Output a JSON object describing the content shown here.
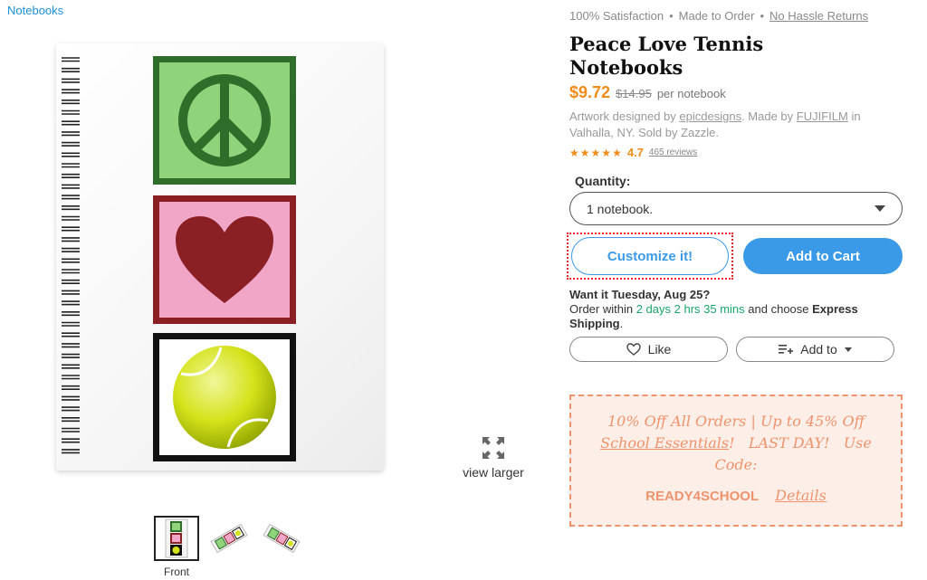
{
  "breadcrumb": {
    "label": "Notebooks"
  },
  "gallery": {
    "view_larger_label": "view larger",
    "thumbnails": [
      {
        "label": "Front",
        "active": true
      },
      {
        "label": "",
        "active": false
      },
      {
        "label": "",
        "active": false
      }
    ]
  },
  "product": {
    "guarantees": [
      "100% Satisfaction",
      "Made to Order",
      "No Hassle Returns"
    ],
    "title_line1": "Peace Love Tennis",
    "title_line2": "Notebooks",
    "price": "$9.72",
    "old_price": "$14.95",
    "price_unit": "per notebook",
    "credits": {
      "prefix": "Artwork designed by",
      "designer": "epicdesigns",
      "made_by": ". Made by",
      "maker": "FUJIFILM",
      "suffix": "in Valhalla, NY. Sold by Zazzle."
    },
    "rating": {
      "value": "4.7",
      "stars": 5,
      "reviews": "465 reviews"
    }
  },
  "quantity": {
    "label": "Quantity:",
    "selected": "1 notebook."
  },
  "actions": {
    "customize": "Customize it!",
    "add_to_cart": "Add to Cart",
    "like": "Like",
    "add_to": "Add to"
  },
  "delivery": {
    "headline": "Want it Tuesday, Aug 25?",
    "prefix": "Order within",
    "countdown": "2 days 2 hrs 35 mins",
    "middle": "and choose",
    "method": "Express Shipping",
    "end": "."
  },
  "promo": {
    "line1": "10% Off All Orders | Up to 45% Off",
    "link": "School Essentials",
    "line2_rest": "!   LAST DAY!   Use Code:",
    "code": "READY4SCHOOL",
    "details": "Details"
  },
  "colors": {
    "accent": "#3a9ae8",
    "price": "#f08c1a",
    "promo": "#f0936c",
    "countdown": "#1aa66b"
  },
  "icons": [
    "peace-icon",
    "heart-icon",
    "tennis-ball-icon",
    "expand-icon",
    "heart-outline-icon",
    "add-to-list-icon",
    "star-icon",
    "caret-down-icon"
  ]
}
